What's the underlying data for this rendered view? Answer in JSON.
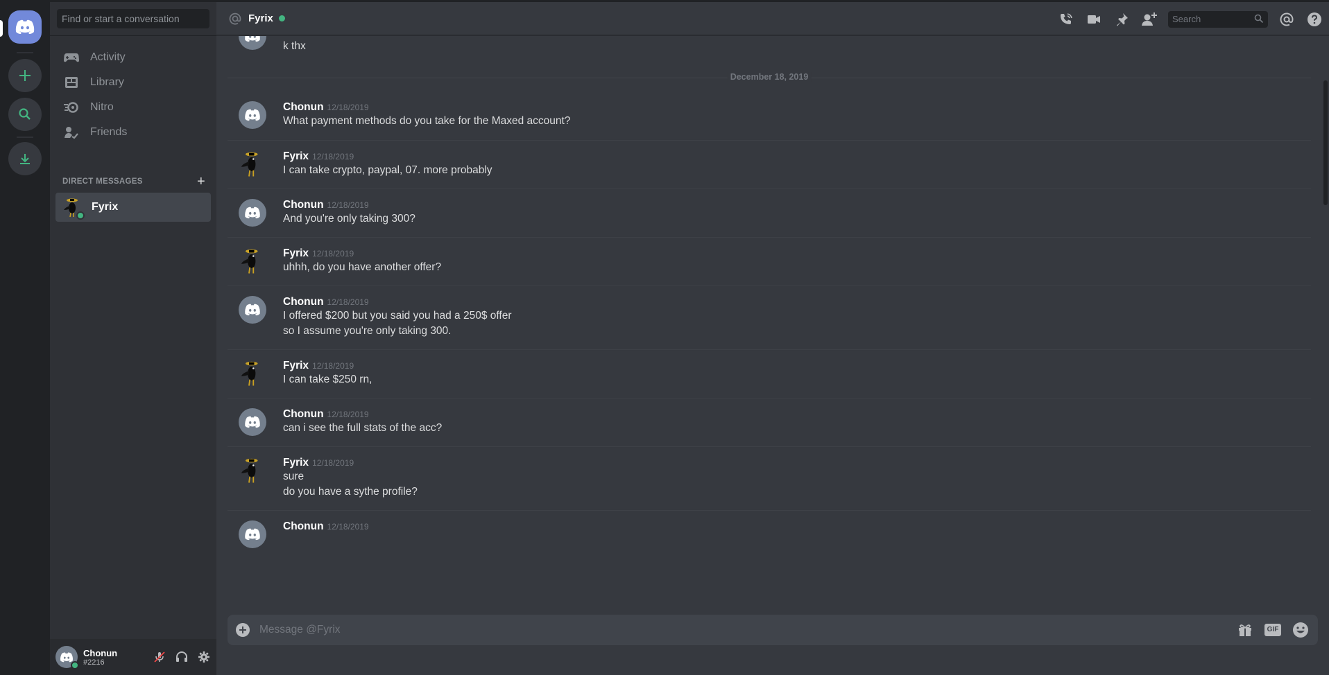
{
  "sidebar": {
    "search_placeholder": "Find or start a conversation",
    "nav": [
      {
        "label": "Activity",
        "icon": "gamepad-icon"
      },
      {
        "label": "Library",
        "icon": "library-icon"
      },
      {
        "label": "Nitro",
        "icon": "nitro-icon"
      },
      {
        "label": "Friends",
        "icon": "friends-icon"
      }
    ],
    "dm_header": "DIRECT MESSAGES",
    "dm_add": "+",
    "dms": [
      {
        "name": "Fyrix",
        "status": "online"
      }
    ]
  },
  "user_panel": {
    "name": "Chonun",
    "tag": "#2216"
  },
  "header": {
    "title": "Fyrix",
    "search_placeholder": "Search"
  },
  "messages": {
    "prev_line": "k thx",
    "date_divider": "December 18, 2019",
    "groups": [
      {
        "author": "Chonun",
        "timestamp": "12/18/2019",
        "lines": [
          "What payment methods do you take for the Maxed account?"
        ]
      },
      {
        "author": "Fyrix",
        "timestamp": "12/18/2019",
        "lines": [
          "I can take crypto, paypal, 07. more probably"
        ]
      },
      {
        "author": "Chonun",
        "timestamp": "12/18/2019",
        "lines": [
          "And you're only taking 300?"
        ]
      },
      {
        "author": "Fyrix",
        "timestamp": "12/18/2019",
        "lines": [
          "uhhh, do you have another offer?"
        ]
      },
      {
        "author": "Chonun",
        "timestamp": "12/18/2019",
        "lines": [
          "I offered $200 but you said you had a 250$ offer",
          "so I assume you're only taking 300."
        ]
      },
      {
        "author": "Fyrix",
        "timestamp": "12/18/2019",
        "lines": [
          "I can take $250 rn,"
        ]
      },
      {
        "author": "Chonun",
        "timestamp": "12/18/2019",
        "lines": [
          "can i see the full stats of the acc?"
        ]
      },
      {
        "author": "Fyrix",
        "timestamp": "12/18/2019",
        "lines": [
          "sure",
          "do you have a sythe profile?"
        ]
      },
      {
        "author": "Chonun",
        "timestamp": "12/18/2019",
        "lines": []
      }
    ]
  },
  "composer": {
    "placeholder": "Message @Fyrix",
    "gif_label": "GIF"
  },
  "colors": {
    "accent": "#7289da",
    "online": "#43b581",
    "bg_main": "#36393f",
    "bg_sidebar": "#2f3136",
    "bg_rail": "#202225"
  }
}
